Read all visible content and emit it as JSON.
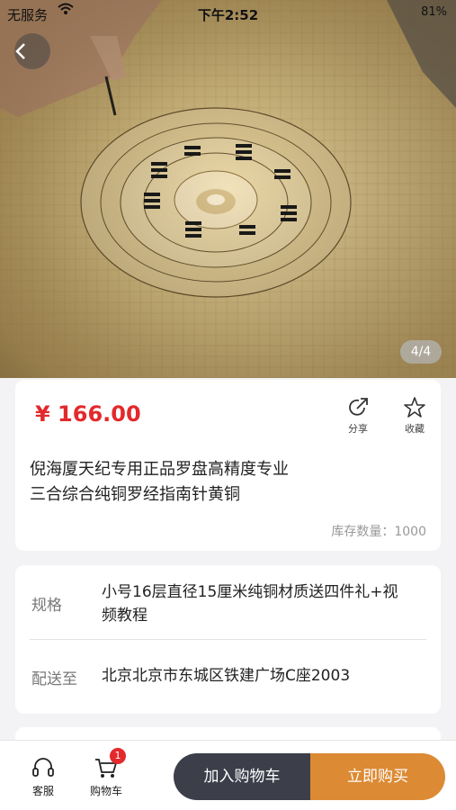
{
  "status_bar": {
    "carrier": "无服务",
    "time": "下午2:52",
    "right": "81%"
  },
  "gallery": {
    "pager": "4/4"
  },
  "product": {
    "price": "¥ 166.00",
    "share_label": "分享",
    "favorite_label": "收藏",
    "title_line1": "倪海厦天纪专用正品罗盘高精度专业",
    "title_line2": "三合综合纯铜罗经指南针黄铜",
    "stock": "库存数量：1000"
  },
  "spec": {
    "spec_label": "规格",
    "spec_line1": "小号16层直径15厘米纯铜材质送四件礼+视",
    "spec_line2": "频教程",
    "delivery_label": "配送至",
    "delivery_value": "北京北京市东城区铁建广场C座2003"
  },
  "bottom_bar": {
    "service_label": "客服",
    "cart_label": "购物车",
    "cart_count": "1",
    "add_to_cart": "加入购物车",
    "buy_now": "立即购买"
  }
}
